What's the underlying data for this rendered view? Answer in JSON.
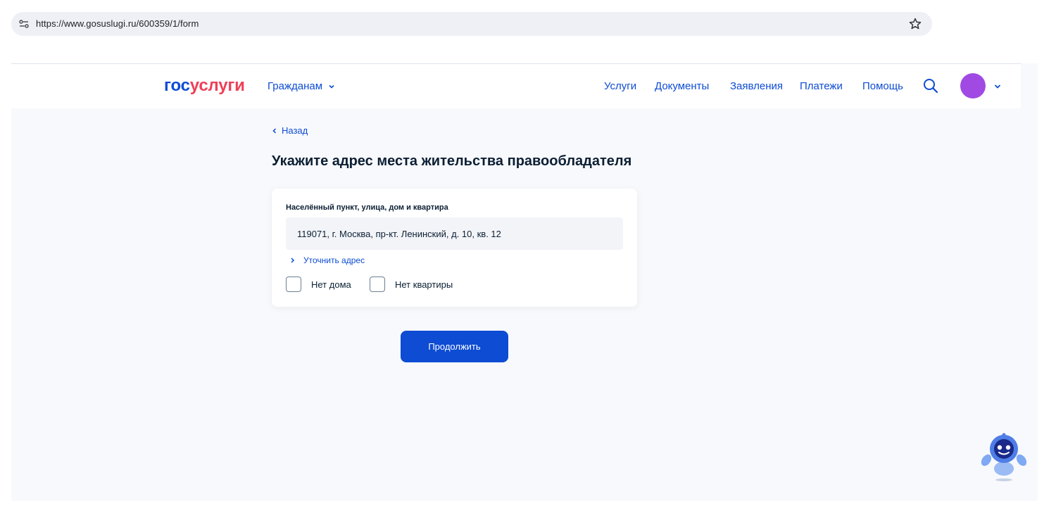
{
  "browser": {
    "url": "https://www.gosuslugi.ru/600359/1/form"
  },
  "header": {
    "logo_part1": "гос",
    "logo_part2": "услуги",
    "audience_label": "Гражданам",
    "nav": [
      "Услуги",
      "Документы",
      "Заявления",
      "Платежи",
      "Помощь"
    ]
  },
  "page": {
    "back_label": "Назад",
    "title": "Укажите адрес места жительства правообладателя"
  },
  "form": {
    "address_label": "Населённый пункт, улица, дом и квартира",
    "address_value": "119071, г. Москва, пр-кт. Ленинский, д. 10, кв. 12",
    "refine_label": "Уточнить адрес",
    "no_house_label": "Нет дома",
    "no_flat_label": "Нет квартиры",
    "continue_label": "Продолжить"
  },
  "colors": {
    "brand_blue": "#0d4cd3",
    "brand_red": "#ee3f58",
    "avatar": "#a04ae3"
  }
}
